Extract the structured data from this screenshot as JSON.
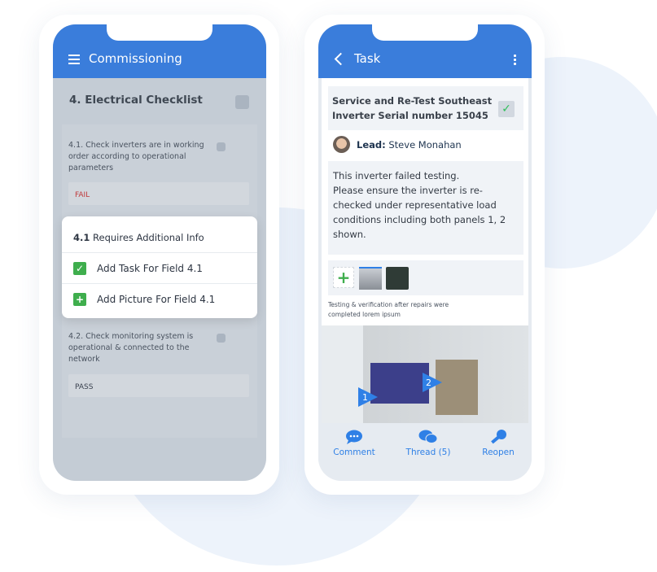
{
  "left_phone": {
    "header": {
      "title": "Commissioning",
      "menu_icon": "hamburger-icon"
    },
    "section_title": "4. Electrical Checklist",
    "items": [
      {
        "text": "4.1. Check inverters are in working order according to operational parameters",
        "value": "FAIL",
        "value_color": "#c0393b"
      },
      {
        "text": "4.2. Check monitoring system is operational & connected to the network",
        "value": "PASS",
        "value_color": "#3b4350"
      }
    ],
    "popup": {
      "number": "4.1",
      "title": "Requires Additional Info",
      "options": [
        {
          "label": "Add Task For Field 4.1",
          "icon": "check-icon"
        },
        {
          "label": "Add Picture For Field 4.1",
          "icon": "plus-icon"
        }
      ]
    }
  },
  "right_phone": {
    "header": {
      "title": "Task",
      "back_icon": "chevron-left-icon",
      "more_icon": "kebab-icon"
    },
    "task_title": "Service and Re-Test Southeast Inverter Serial number 15045",
    "lead_label": "Lead:",
    "lead_name": "Steve Monahan",
    "description": "This inverter failed testing.\nPlease  ensure the inverter is re-checked under representative load conditions including both panels 1, 2 shown.",
    "caption": "Testing & verification after repairs were completed lorem ipsum",
    "markers": [
      "1",
      "2"
    ],
    "actions": [
      {
        "label": "Comment",
        "icon": "comment-icon"
      },
      {
        "label": "Thread (5)",
        "icon": "thread-icon"
      },
      {
        "label": "Reopen",
        "icon": "key-icon"
      }
    ]
  },
  "colors": {
    "primary": "#3a7ddb",
    "success": "#3fae4d",
    "fail": "#c0393b"
  }
}
